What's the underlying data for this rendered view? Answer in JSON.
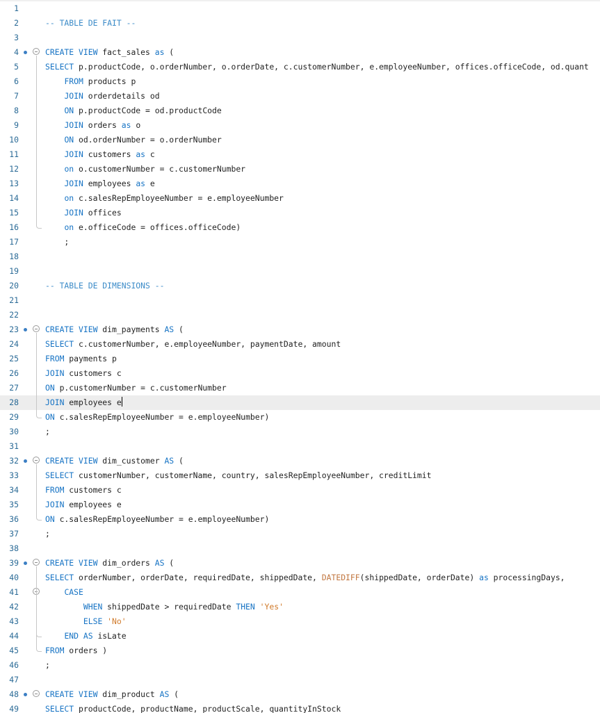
{
  "editor": {
    "language": "SQL",
    "current_line": 28,
    "caret_after_token": "e",
    "breakpoint_lines": [
      4,
      23,
      32,
      39,
      48
    ],
    "fold_lines": [
      4,
      23,
      32,
      39,
      41,
      48
    ],
    "colors": {
      "keyword": "#1673c4",
      "comment": "#3b8bc8",
      "string": "#d07a2a",
      "function": "#c27740",
      "line_number": "#2a6a96",
      "current_line_bg": "#ededed"
    },
    "lines": [
      {
        "n": "1",
        "tokens": []
      },
      {
        "n": "2",
        "tokens": [
          [
            "cm",
            "-- TABLE DE FAIT --"
          ]
        ]
      },
      {
        "n": "3",
        "tokens": []
      },
      {
        "n": "4",
        "tokens": [
          [
            "kw",
            "CREATE VIEW"
          ],
          [
            "tx",
            " fact_sales "
          ],
          [
            "kw",
            "as"
          ],
          [
            "tx",
            " ("
          ]
        ]
      },
      {
        "n": "5",
        "tokens": [
          [
            "kw",
            "SELECT"
          ],
          [
            "tx",
            " p.productCode, o.orderNumber, o.orderDate, c.customerNumber, e.employeeNumber, offices.officeCode, od.quant"
          ]
        ]
      },
      {
        "n": "6",
        "tokens": [
          [
            "tx",
            "    "
          ],
          [
            "kw",
            "FROM"
          ],
          [
            "tx",
            " products p"
          ]
        ]
      },
      {
        "n": "7",
        "tokens": [
          [
            "tx",
            "    "
          ],
          [
            "kw",
            "JOIN"
          ],
          [
            "tx",
            " orderdetails od"
          ]
        ]
      },
      {
        "n": "8",
        "tokens": [
          [
            "tx",
            "    "
          ],
          [
            "kw",
            "ON"
          ],
          [
            "tx",
            " p.productCode = od.productCode"
          ]
        ]
      },
      {
        "n": "9",
        "tokens": [
          [
            "tx",
            "    "
          ],
          [
            "kw",
            "JOIN"
          ],
          [
            "tx",
            " orders "
          ],
          [
            "kw",
            "as"
          ],
          [
            "tx",
            " o"
          ]
        ]
      },
      {
        "n": "10",
        "tokens": [
          [
            "tx",
            "    "
          ],
          [
            "kw",
            "ON"
          ],
          [
            "tx",
            " od.orderNumber = o.orderNumber"
          ]
        ]
      },
      {
        "n": "11",
        "tokens": [
          [
            "tx",
            "    "
          ],
          [
            "kw",
            "JOIN"
          ],
          [
            "tx",
            " customers "
          ],
          [
            "kw",
            "as"
          ],
          [
            "tx",
            " c"
          ]
        ]
      },
      {
        "n": "12",
        "tokens": [
          [
            "tx",
            "    "
          ],
          [
            "kw",
            "on"
          ],
          [
            "tx",
            " o.customerNumber = c.customerNumber"
          ]
        ]
      },
      {
        "n": "13",
        "tokens": [
          [
            "tx",
            "    "
          ],
          [
            "kw",
            "JOIN"
          ],
          [
            "tx",
            " employees "
          ],
          [
            "kw",
            "as"
          ],
          [
            "tx",
            " e"
          ]
        ]
      },
      {
        "n": "14",
        "tokens": [
          [
            "tx",
            "    "
          ],
          [
            "kw",
            "on"
          ],
          [
            "tx",
            " c.salesRepEmployeeNumber = e.employeeNumber"
          ]
        ]
      },
      {
        "n": "15",
        "tokens": [
          [
            "tx",
            "    "
          ],
          [
            "kw",
            "JOIN"
          ],
          [
            "tx",
            " offices"
          ]
        ]
      },
      {
        "n": "16",
        "tokens": [
          [
            "tx",
            "    "
          ],
          [
            "kw",
            "on"
          ],
          [
            "tx",
            " e.officeCode = offices.officeCode)"
          ]
        ]
      },
      {
        "n": "17",
        "tokens": [
          [
            "tx",
            "    ;"
          ]
        ]
      },
      {
        "n": "18",
        "tokens": []
      },
      {
        "n": "19",
        "tokens": []
      },
      {
        "n": "20",
        "tokens": [
          [
            "cm",
            "-- TABLE DE DIMENSIONS --"
          ]
        ]
      },
      {
        "n": "21",
        "tokens": []
      },
      {
        "n": "22",
        "tokens": []
      },
      {
        "n": "23",
        "tokens": [
          [
            "kw",
            "CREATE VIEW"
          ],
          [
            "tx",
            " dim_payments "
          ],
          [
            "kw",
            "AS"
          ],
          [
            "tx",
            " ("
          ]
        ]
      },
      {
        "n": "24",
        "tokens": [
          [
            "kw",
            "SELECT"
          ],
          [
            "tx",
            " c.customerNumber, e.employeeNumber, paymentDate, amount"
          ]
        ]
      },
      {
        "n": "25",
        "tokens": [
          [
            "kw",
            "FROM"
          ],
          [
            "tx",
            " payments p"
          ]
        ]
      },
      {
        "n": "26",
        "tokens": [
          [
            "kw",
            "JOIN"
          ],
          [
            "tx",
            " customers c"
          ]
        ]
      },
      {
        "n": "27",
        "tokens": [
          [
            "kw",
            "ON"
          ],
          [
            "tx",
            " p.customerNumber = c.customerNumber"
          ]
        ]
      },
      {
        "n": "28",
        "tokens": [
          [
            "kw",
            "JOIN"
          ],
          [
            "tx",
            " employees e"
          ]
        ]
      },
      {
        "n": "29",
        "tokens": [
          [
            "kw",
            "ON"
          ],
          [
            "tx",
            " c.salesRepEmployeeNumber = e.employeeNumber)"
          ]
        ]
      },
      {
        "n": "30",
        "tokens": [
          [
            "tx",
            ";"
          ]
        ]
      },
      {
        "n": "31",
        "tokens": []
      },
      {
        "n": "32",
        "tokens": [
          [
            "kw",
            "CREATE VIEW"
          ],
          [
            "tx",
            " dim_customer "
          ],
          [
            "kw",
            "AS"
          ],
          [
            "tx",
            " ("
          ]
        ]
      },
      {
        "n": "33",
        "tokens": [
          [
            "kw",
            "SELECT"
          ],
          [
            "tx",
            " customerNumber, customerName, country, salesRepEmployeeNumber, creditLimit"
          ]
        ]
      },
      {
        "n": "34",
        "tokens": [
          [
            "kw",
            "FROM"
          ],
          [
            "tx",
            " customers c"
          ]
        ]
      },
      {
        "n": "35",
        "tokens": [
          [
            "kw",
            "JOIN"
          ],
          [
            "tx",
            " employees e"
          ]
        ]
      },
      {
        "n": "36",
        "tokens": [
          [
            "kw",
            "ON"
          ],
          [
            "tx",
            " c.salesRepEmployeeNumber = e.employeeNumber)"
          ]
        ]
      },
      {
        "n": "37",
        "tokens": [
          [
            "tx",
            ";"
          ]
        ]
      },
      {
        "n": "38",
        "tokens": []
      },
      {
        "n": "39",
        "tokens": [
          [
            "kw",
            "CREATE VIEW"
          ],
          [
            "tx",
            " dim_orders "
          ],
          [
            "kw",
            "AS"
          ],
          [
            "tx",
            " ("
          ]
        ]
      },
      {
        "n": "40",
        "tokens": [
          [
            "kw",
            "SELECT"
          ],
          [
            "tx",
            " orderNumber, orderDate, requiredDate, shippedDate, "
          ],
          [
            "fn",
            "DATEDIFF"
          ],
          [
            "tx",
            "(shippedDate, orderDate) "
          ],
          [
            "kw",
            "as"
          ],
          [
            "tx",
            " processingDays,"
          ]
        ]
      },
      {
        "n": "41",
        "tokens": [
          [
            "tx",
            "    "
          ],
          [
            "kw",
            "CASE"
          ]
        ]
      },
      {
        "n": "42",
        "tokens": [
          [
            "tx",
            "        "
          ],
          [
            "kw",
            "WHEN"
          ],
          [
            "tx",
            " shippedDate > requiredDate "
          ],
          [
            "kw",
            "THEN"
          ],
          [
            "tx",
            " "
          ],
          [
            "st",
            "'Yes'"
          ]
        ]
      },
      {
        "n": "43",
        "tokens": [
          [
            "tx",
            "        "
          ],
          [
            "kw",
            "ELSE"
          ],
          [
            "tx",
            " "
          ],
          [
            "st",
            "'No'"
          ]
        ]
      },
      {
        "n": "44",
        "tokens": [
          [
            "tx",
            "    "
          ],
          [
            "kw",
            "END AS"
          ],
          [
            "tx",
            " isLate"
          ]
        ]
      },
      {
        "n": "45",
        "tokens": [
          [
            "kw",
            "FROM"
          ],
          [
            "tx",
            " orders )"
          ]
        ]
      },
      {
        "n": "46",
        "tokens": [
          [
            "tx",
            ";"
          ]
        ]
      },
      {
        "n": "47",
        "tokens": []
      },
      {
        "n": "48",
        "tokens": [
          [
            "kw",
            "CREATE VIEW"
          ],
          [
            "tx",
            " dim_product "
          ],
          [
            "kw",
            "AS"
          ],
          [
            "tx",
            " ("
          ]
        ]
      },
      {
        "n": "49",
        "tokens": [
          [
            "kw",
            "SELECT"
          ],
          [
            "tx",
            " productCode, productName, productScale, quantityInStock"
          ]
        ]
      }
    ]
  }
}
